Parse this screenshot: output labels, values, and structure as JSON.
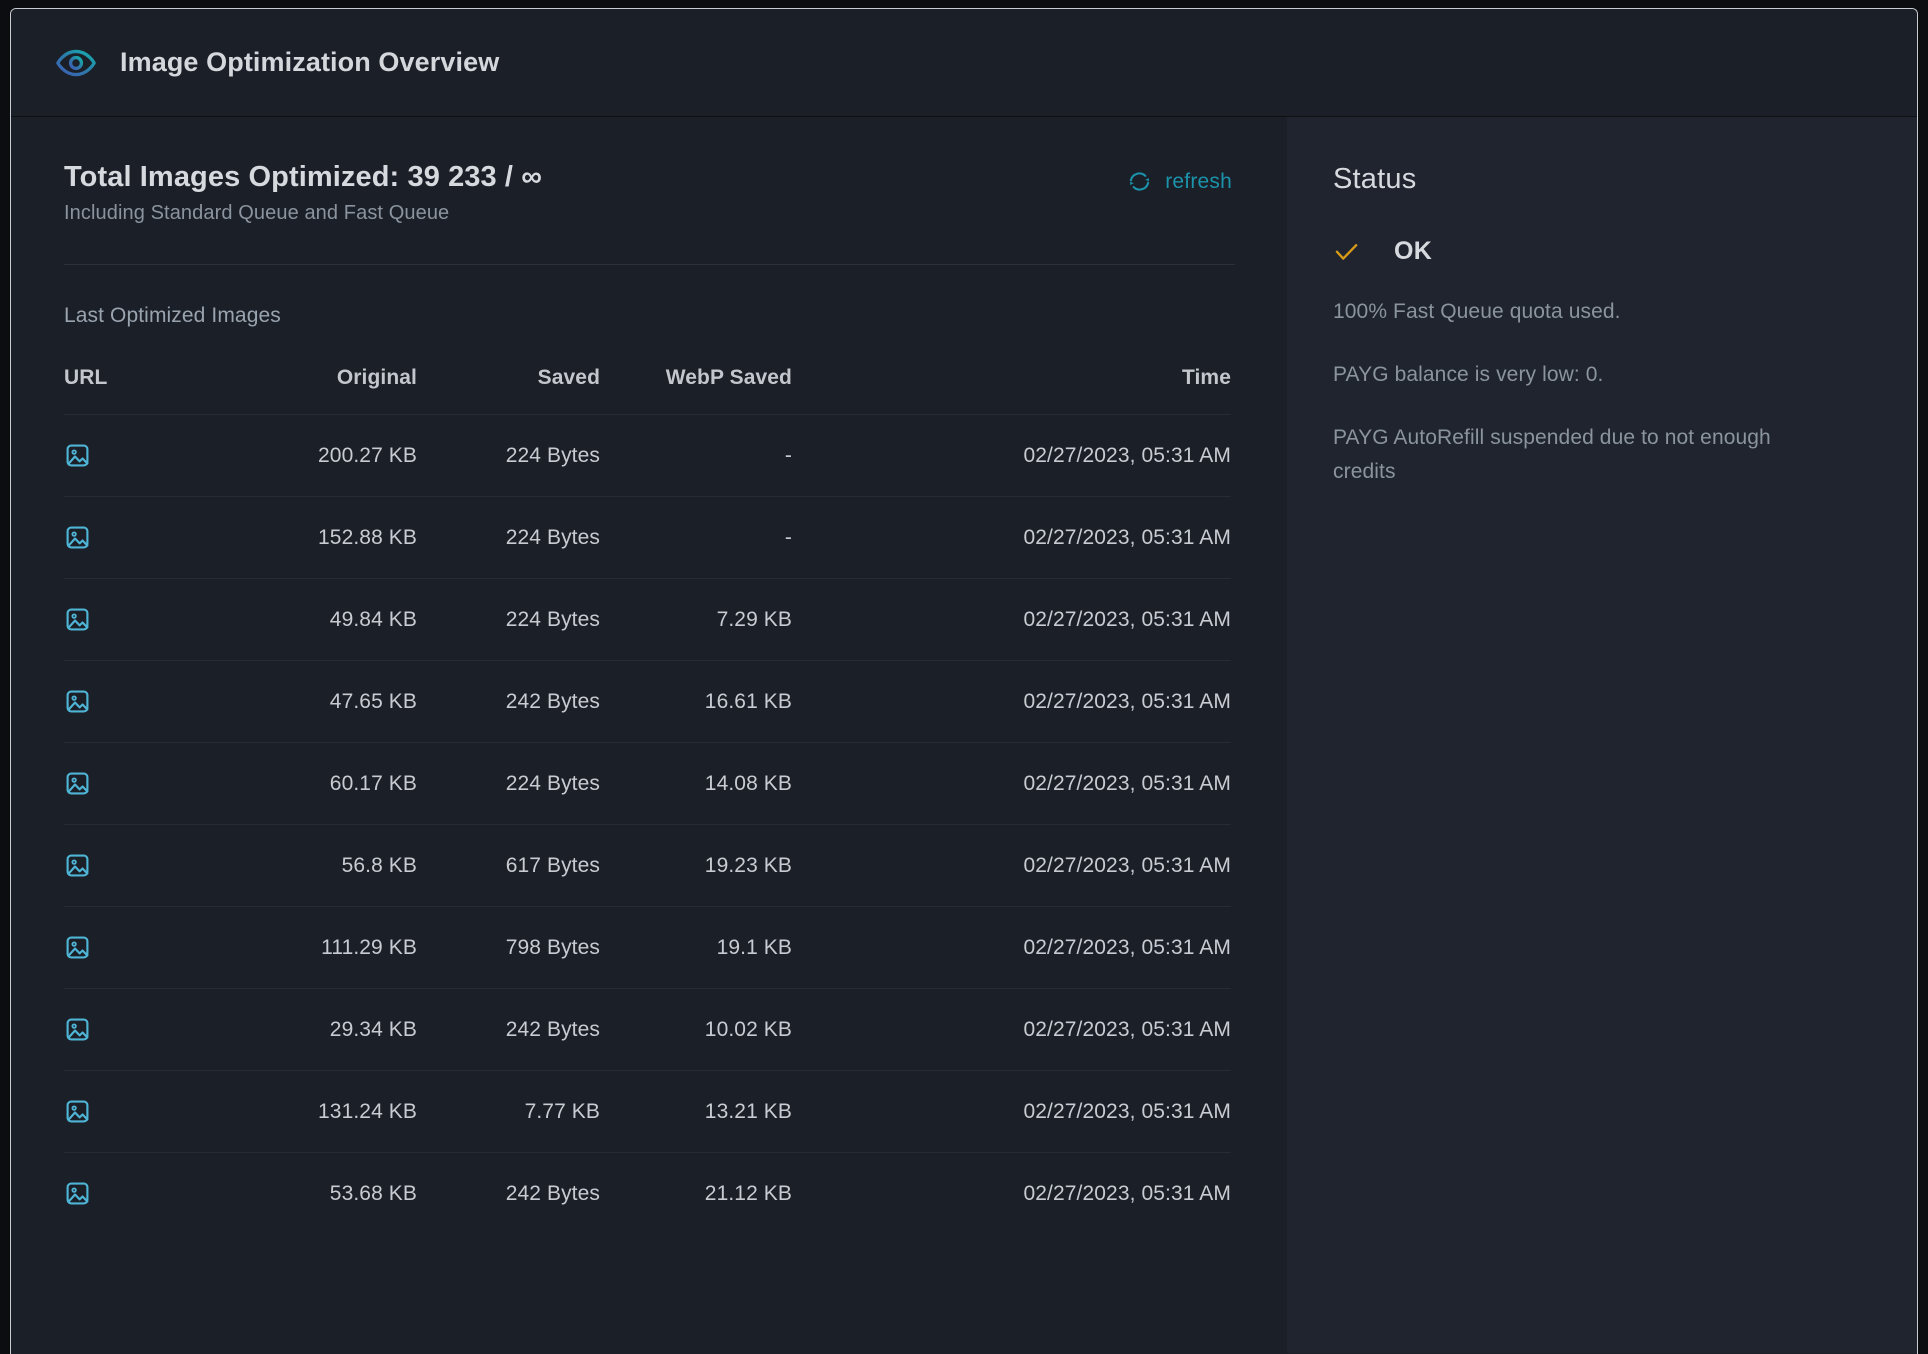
{
  "header": {
    "title": "Image Optimization Overview",
    "icon": "eye-icon"
  },
  "summary": {
    "total_title": "Total Images Optimized: 39 233 / ∞",
    "total_subtitle": "Including Standard Queue and Fast Queue",
    "refresh_label": "refresh",
    "refresh_icon": "refresh-icon"
  },
  "table": {
    "section_label": "Last Optimized Images",
    "columns": [
      "URL",
      "Original",
      "Saved",
      "WebP Saved",
      "Time"
    ],
    "row_icon": "image-icon",
    "rows": [
      {
        "url_icon": "image-icon",
        "original": "200.27 KB",
        "saved": "224 Bytes",
        "webp_saved": "-",
        "time": "02/27/2023, 05:31 AM"
      },
      {
        "url_icon": "image-icon",
        "original": "152.88 KB",
        "saved": "224 Bytes",
        "webp_saved": "-",
        "time": "02/27/2023, 05:31 AM"
      },
      {
        "url_icon": "image-icon",
        "original": "49.84 KB",
        "saved": "224 Bytes",
        "webp_saved": "7.29 KB",
        "time": "02/27/2023, 05:31 AM"
      },
      {
        "url_icon": "image-icon",
        "original": "47.65 KB",
        "saved": "242 Bytes",
        "webp_saved": "16.61 KB",
        "time": "02/27/2023, 05:31 AM"
      },
      {
        "url_icon": "image-icon",
        "original": "60.17 KB",
        "saved": "224 Bytes",
        "webp_saved": "14.08 KB",
        "time": "02/27/2023, 05:31 AM"
      },
      {
        "url_icon": "image-icon",
        "original": "56.8 KB",
        "saved": "617 Bytes",
        "webp_saved": "19.23 KB",
        "time": "02/27/2023, 05:31 AM"
      },
      {
        "url_icon": "image-icon",
        "original": "111.29 KB",
        "saved": "798 Bytes",
        "webp_saved": "19.1 KB",
        "time": "02/27/2023, 05:31 AM"
      },
      {
        "url_icon": "image-icon",
        "original": "29.34 KB",
        "saved": "242 Bytes",
        "webp_saved": "10.02 KB",
        "time": "02/27/2023, 05:31 AM"
      },
      {
        "url_icon": "image-icon",
        "original": "131.24 KB",
        "saved": "7.77 KB",
        "webp_saved": "13.21 KB",
        "time": "02/27/2023, 05:31 AM"
      },
      {
        "url_icon": "image-icon",
        "original": "53.68 KB",
        "saved": "242 Bytes",
        "webp_saved": "21.12 KB",
        "time": "02/27/2023, 05:31 AM"
      }
    ]
  },
  "status": {
    "heading": "Status",
    "state_icon": "check-icon",
    "state_label": "OK",
    "messages": [
      "100% Fast Queue quota used.",
      "PAYG balance is very low: 0.",
      "PAYG AutoRefill suspended due to not enough credits"
    ]
  },
  "colors": {
    "page_background": "#0c0d10",
    "card_background": "#1b1f27",
    "status_panel_background": "#1f242e",
    "card_border": "#c9ccd1",
    "accent_teal": "#1b93ab",
    "icon_cyan": "#4fb5d6",
    "status_ok_amber": "#d79a18",
    "text_primary": "#d6d9de",
    "text_secondary": "#8b949e",
    "text_muted": "#79828d",
    "row_divider": "#262c35"
  }
}
